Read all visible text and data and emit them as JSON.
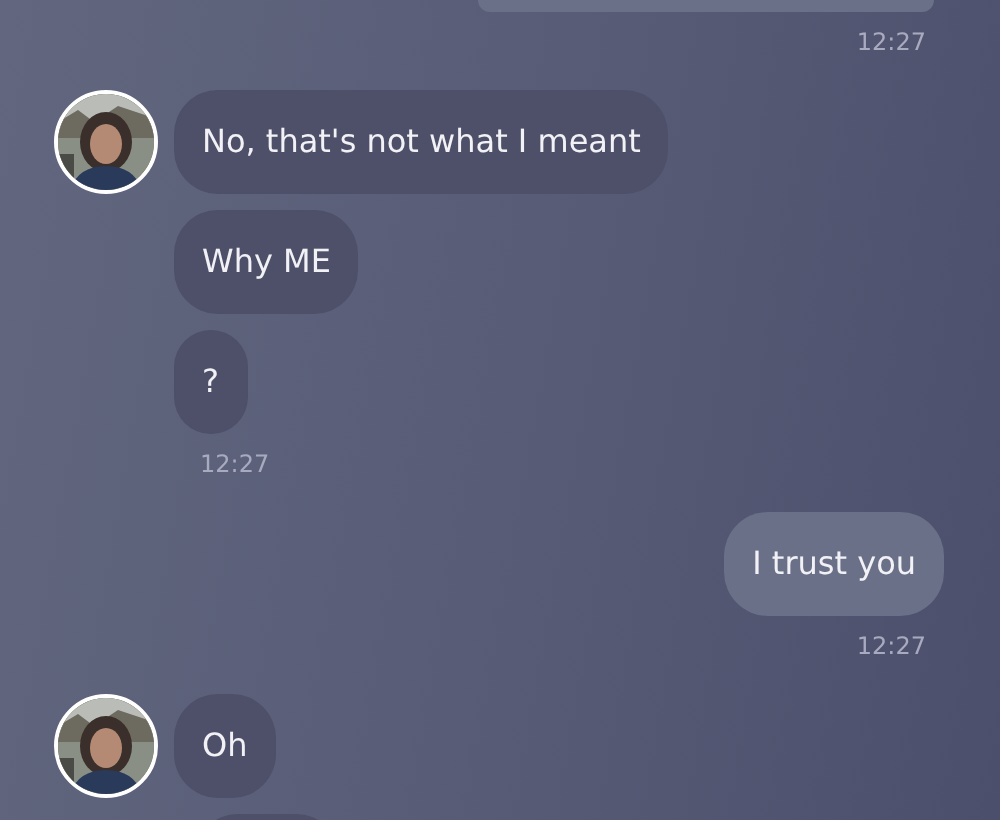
{
  "groups": [
    {
      "outgoing": true,
      "messages": [
        {
          "kind": "partial"
        }
      ],
      "time": "12:27"
    },
    {
      "outgoing": false,
      "avatar": {
        "kind": "picture"
      },
      "messages": [
        {
          "kind": "text",
          "text": "No, that's not what I meant"
        },
        {
          "kind": "text",
          "text": "Why ME"
        },
        {
          "kind": "text",
          "text": "?"
        }
      ],
      "time": "12:27"
    },
    {
      "outgoing": true,
      "messages": [
        {
          "kind": "text",
          "text": "I trust you"
        }
      ],
      "time": "12:27"
    },
    {
      "outgoing": false,
      "avatar": {
        "kind": "picture"
      },
      "messages": [
        {
          "kind": "text",
          "text": "Oh"
        },
        {
          "kind": "partial"
        }
      ]
    }
  ]
}
